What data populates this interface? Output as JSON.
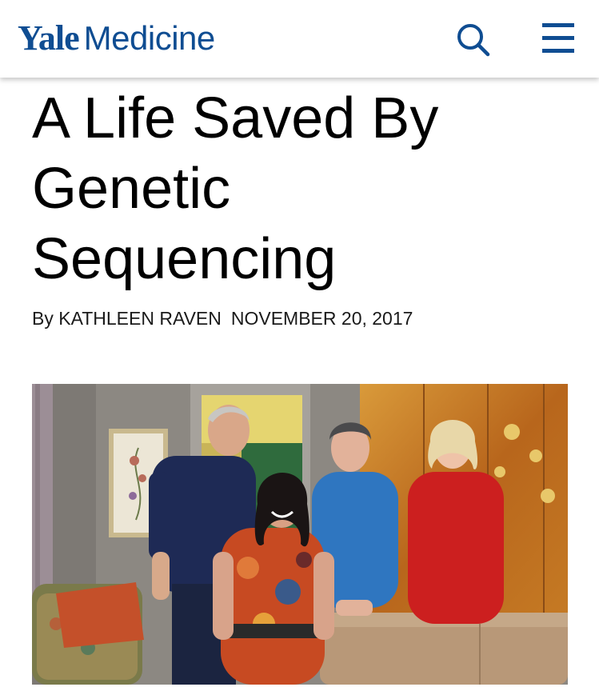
{
  "header": {
    "logo_yale": "Yale",
    "logo_medicine": "Medicine",
    "brand_color": "#0f4d92",
    "search_icon": "search-icon",
    "menu_icon": "hamburger-menu-icon"
  },
  "article": {
    "title_lines": [
      "A Life Saved By",
      "Genetic",
      "Sequencing"
    ],
    "byline_author": "By KATHLEEN RAVEN",
    "byline_date": "NOVEMBER 20, 2017"
  }
}
